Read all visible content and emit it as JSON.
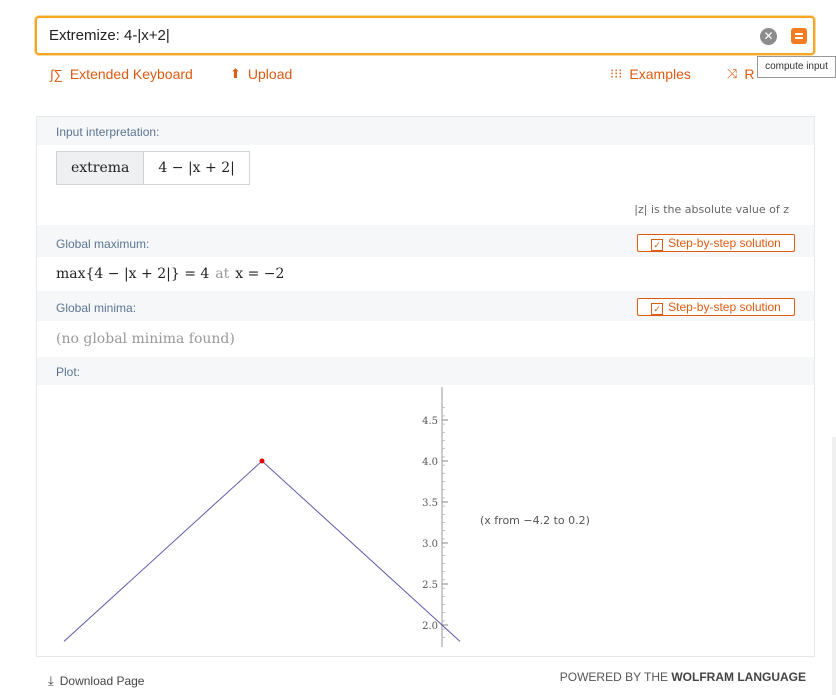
{
  "search": {
    "query": "Extremize: 4-|x+2|",
    "clear_symbol": "✕",
    "tooltip": "compute input"
  },
  "toolbar": {
    "extended_keyboard": "Extended Keyboard",
    "upload": "Upload",
    "examples": "Examples",
    "random_partial": "R"
  },
  "pods": {
    "input_interpretation": {
      "title": "Input interpretation:",
      "cell1": "extrema",
      "cell2": "4 − |x + 2|",
      "note": "|z| is the absolute value of z"
    },
    "global_maximum": {
      "title": "Global maximum:",
      "button": "Step-by-step solution",
      "expr": "max{4 − |x + 2|} = 4",
      "at": "at",
      "where": "x = −2"
    },
    "global_minima": {
      "title": "Global minima:",
      "button": "Step-by-step solution",
      "result": "(no global minima found)"
    },
    "plot": {
      "title": "Plot:",
      "range_note": "(x from −4.2 to 0.2)"
    }
  },
  "chart_data": {
    "type": "line",
    "function": "4-|x+2|",
    "x": [
      -4.2,
      -2,
      0.2
    ],
    "y": [
      1.8,
      4,
      1.8
    ],
    "highlight_point": {
      "x": -2,
      "y": 4,
      "color": "#e00000"
    },
    "line_color": "#5a5aaa",
    "ytick_labels": [
      "2.0",
      "2.5",
      "3.0",
      "3.5",
      "4.0",
      "4.5"
    ],
    "yticks": [
      2.0,
      2.5,
      3.0,
      3.5,
      4.0,
      4.5
    ],
    "xlim": [
      -4.2,
      0.2
    ],
    "ylim": [
      1.8,
      4.7
    ]
  },
  "footer": {
    "download": "Download Page",
    "powered_prefix": "POWERED BY THE",
    "powered_brand": "WOLFRAM LANGUAGE"
  },
  "colors": {
    "accent": "#dd5a11",
    "search_border": "#f5a623",
    "pod_title": "#5d7591"
  }
}
